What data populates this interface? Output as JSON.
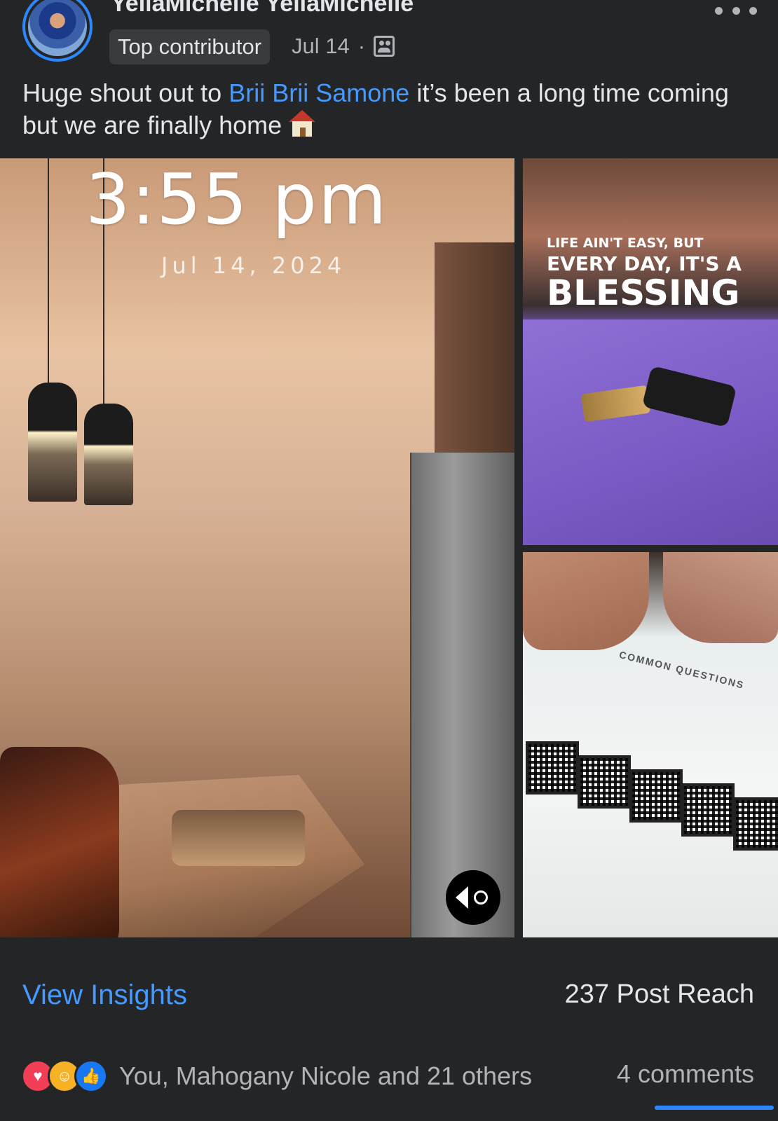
{
  "post": {
    "author": "YellaMichelle YellaMichelle",
    "badge": "Top contributor",
    "date": "Jul 14",
    "separator": "·",
    "text_before": "Huge shout out to ",
    "mention": "Brii Brii Samone",
    "text_after": " it’s been a long time coming but we are finally home ",
    "more_icon": "more-options-icon",
    "audience_icon": "audience-icon"
  },
  "photos": {
    "main_time": "3:55 pm",
    "main_date": "Jul 14, 2024",
    "quote_line1": "LIFE AIN'T EASY, BUT",
    "quote_line2": "EVERY DAY, IT'S A",
    "quote_line3": "BLESSING",
    "doc_heading": "COMMON QUESTIONS"
  },
  "footer": {
    "insights_label": "View Insights",
    "reach": "237 Post Reach",
    "reactors": "You, Mahogany Nicole and 21 others",
    "comments": "4 comments"
  },
  "colors": {
    "background": "#242526",
    "link": "#4599ff",
    "avatar_ring": "#2d88ff",
    "love": "#f33e58",
    "care": "#f7b125",
    "like": "#1877f2"
  }
}
